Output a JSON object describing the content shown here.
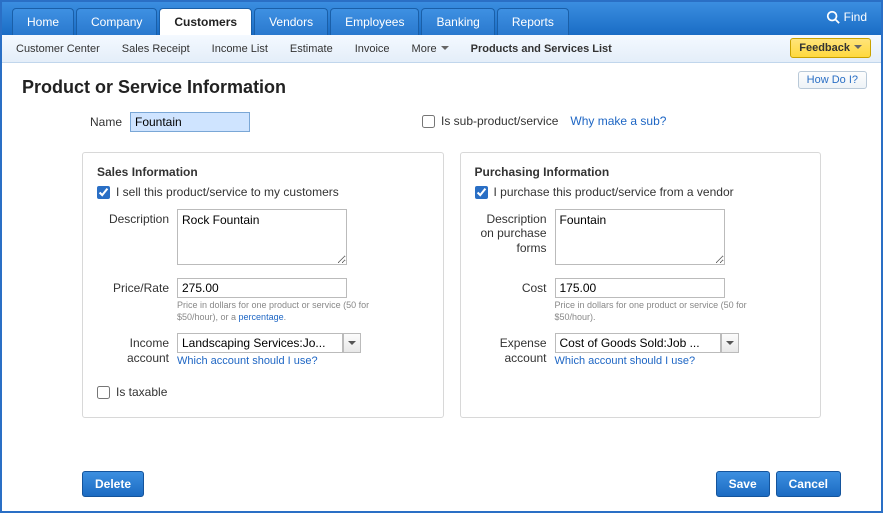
{
  "topnav": {
    "tabs": [
      "Home",
      "Company",
      "Customers",
      "Vendors",
      "Employees",
      "Banking",
      "Reports"
    ],
    "active_index": 2,
    "find_label": "Find"
  },
  "subnav": {
    "items": [
      "Customer Center",
      "Sales Receipt",
      "Income List",
      "Estimate",
      "Invoice"
    ],
    "more_label": "More",
    "active_label": "Products and Services List",
    "feedback_label": "Feedback"
  },
  "page": {
    "title": "Product or Service Information",
    "how_do_i": "How Do I?"
  },
  "name_field": {
    "label": "Name",
    "value": "Fountain"
  },
  "sub_product": {
    "label": "Is sub-product/service",
    "link": "Why make a sub?",
    "checked": false
  },
  "sales_panel": {
    "title": "Sales Information",
    "sell_checkbox_label": "I sell this product/service to my customers",
    "sell_checked": true,
    "description_label": "Description",
    "description_value": "Rock Fountain",
    "price_label": "Price/Rate",
    "price_value": "275.00",
    "price_hint_prefix": "Price in dollars for one product or service (50 for $50/hour), or a ",
    "price_hint_link": "percentage",
    "income_label": "Income account",
    "income_value": "Landscaping Services:Jo...",
    "account_link": "Which account should I use?",
    "taxable_label": "Is taxable",
    "taxable_checked": false
  },
  "purchase_panel": {
    "title": "Purchasing Information",
    "buy_checkbox_label": "I purchase this product/service from a vendor",
    "buy_checked": true,
    "description_label": "Description on purchase forms",
    "description_value": "Fountain",
    "cost_label": "Cost",
    "cost_value": "175.00",
    "cost_hint": "Price in dollars for one product or service (50 for $50/hour).",
    "expense_label": "Expense account",
    "expense_value": "Cost of Goods Sold:Job ...",
    "account_link": "Which account should I use?"
  },
  "footer": {
    "delete": "Delete",
    "save": "Save",
    "cancel": "Cancel"
  }
}
